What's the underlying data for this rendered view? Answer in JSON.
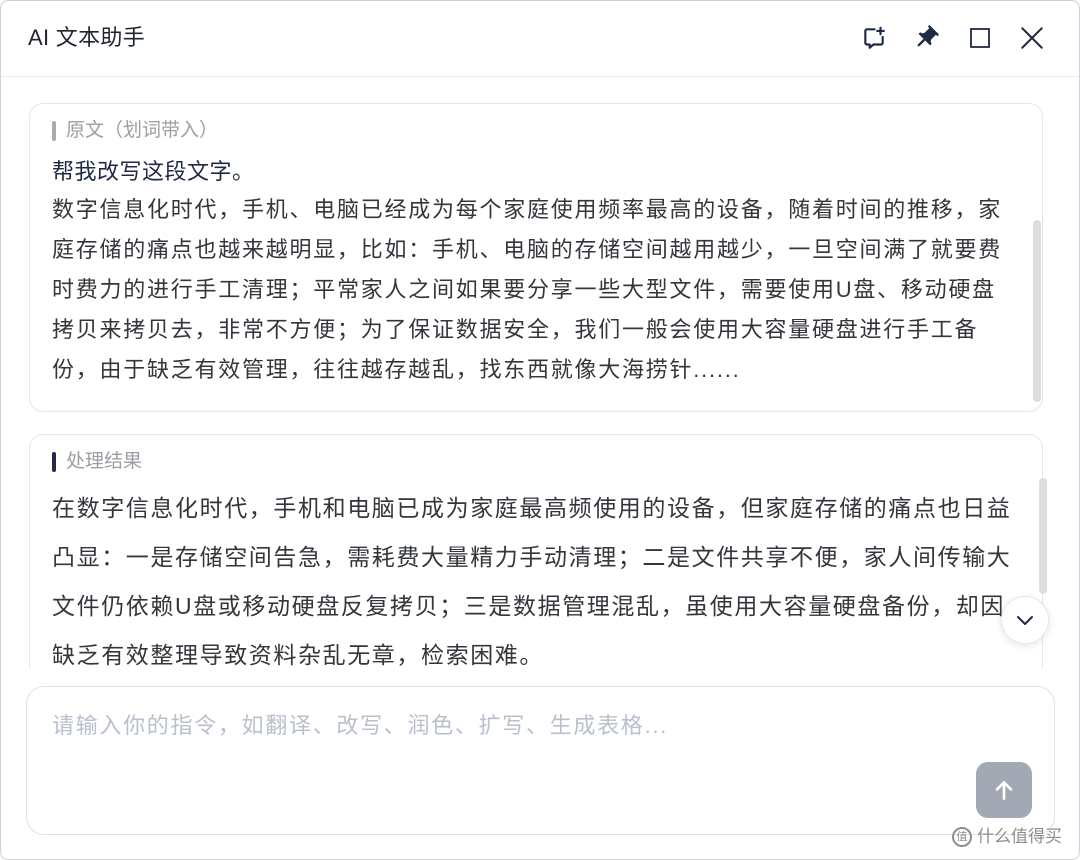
{
  "window": {
    "title": "AI 文本助手"
  },
  "titlebar": {
    "buttons": [
      {
        "icon": "new-chat-icon"
      },
      {
        "icon": "pin-icon"
      },
      {
        "icon": "maximize-icon"
      },
      {
        "icon": "close-icon"
      }
    ]
  },
  "source_card": {
    "label": "原文（划词带入）",
    "instruction": "帮我改写这段文字。",
    "text": "数字信息化时代，手机、电脑已经成为每个家庭使用频率最高的设备，随着时间的推移，家庭存储的痛点也越来越明显，比如：手机、电脑的存储空间越用越少，一旦空间满了就要费时费力的进行手工清理；平常家人之间如果要分享一些大型文件，需要使用U盘、移动硬盘拷贝来拷贝去，非常不方便；为了保证数据安全，我们一般会使用大容量硬盘进行手工备份，由于缺乏有效管理，往往越存越乱，找东西就像大海捞针......"
  },
  "result_card": {
    "label": "处理结果",
    "text": "在数字信息化时代，手机和电脑已成为家庭最高频使用的设备，但家庭存储的痛点也日益凸显：一是存储空间告急，需耗费大量精力手动清理；二是文件共享不便，家人间传输大文件仍依赖U盘或移动硬盘反复拷贝；三是数据管理混乱，虽使用大容量硬盘备份，却因缺乏有效整理导致资料杂乱无章，检索困难。"
  },
  "scroll_button": {
    "icon": "chevron-down-icon"
  },
  "input": {
    "placeholder": "请输入你的指令，如翻译、改写、润色、扩写、生成表格...",
    "send_icon": "arrow-up-icon"
  },
  "watermark": {
    "logo": "值",
    "text": "什么值得买"
  },
  "colors": {
    "accent": "#1f2a44",
    "muted_bar": "#a9abb0",
    "send_button": "#a3a9b4",
    "placeholder": "#b8c0cc"
  }
}
